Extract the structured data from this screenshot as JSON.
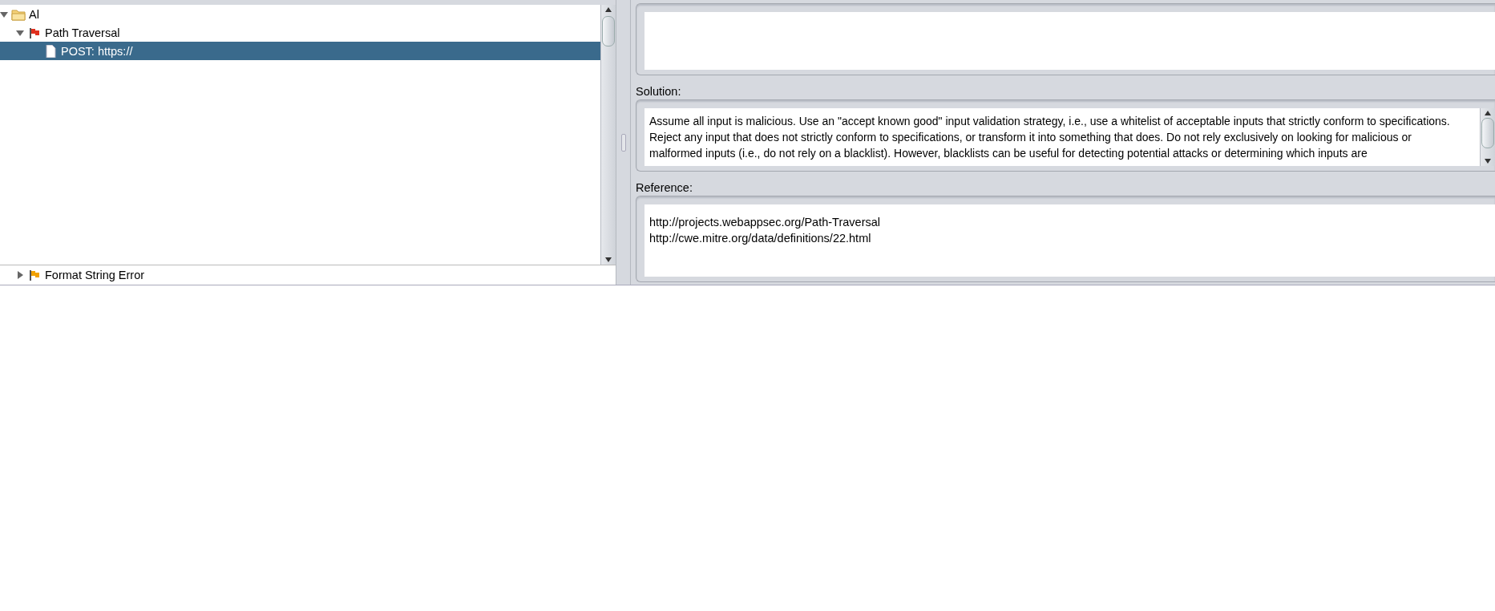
{
  "tree": [
    {
      "label": "Al",
      "kind": "folder",
      "expanded": true,
      "selected": false,
      "children": [
        {
          "label": "Path Traversal",
          "kind": "flag",
          "color": "#e0301e",
          "expanded": true,
          "selected": false,
          "children": [
            {
              "label": "POST: https://",
              "kind": "page",
              "selected": true
            }
          ]
        }
      ]
    }
  ],
  "lower_tree": [
    {
      "label": "Format String Error",
      "kind": "flag",
      "color": "#f0a000",
      "expanded": false,
      "selected": false
    }
  ],
  "details": {
    "solution_label": "Solution:",
    "solution": "Assume all input is malicious. Use an \"accept known good\" input validation strategy, i.e., use a whitelist of acceptable inputs that strictly conform to specifications. Reject any input that does not strictly conform to specifications, or transform it into something that does. Do not rely exclusively on looking for malicious or malformed inputs (i.e., do not rely on a blacklist). However, blacklists can be useful for detecting potential attacks or determining which inputs are",
    "reference_label": "Reference:",
    "references": [
      "http://projects.webappsec.org/Path-Traversal",
      "http://cwe.mitre.org/data/definitions/22.html"
    ]
  }
}
